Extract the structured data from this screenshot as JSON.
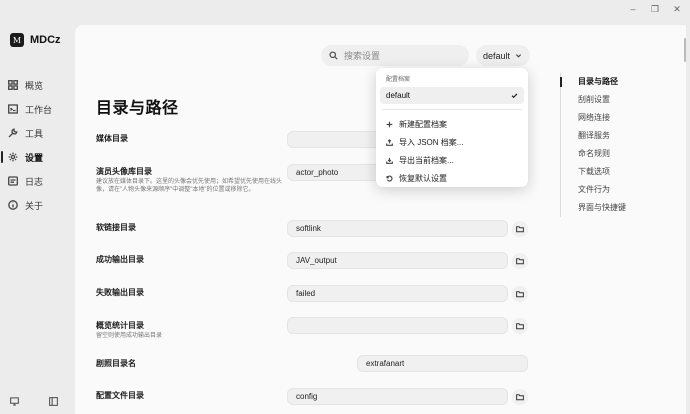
{
  "app": {
    "name": "MDCz",
    "logo_glyph": "M"
  },
  "window_controls": [
    "–",
    "❐",
    "✕"
  ],
  "sidebar": {
    "items": [
      {
        "label": "概览",
        "icon": "grid-icon",
        "active": false
      },
      {
        "label": "工作台",
        "icon": "terminal-icon",
        "active": false
      },
      {
        "label": "工具",
        "icon": "wrench-icon",
        "active": false
      },
      {
        "label": "设置",
        "icon": "gear-icon",
        "active": true
      },
      {
        "label": "日志",
        "icon": "log-icon",
        "active": false
      },
      {
        "label": "关于",
        "icon": "info-icon",
        "active": false
      }
    ]
  },
  "search": {
    "placeholder": "搜索设置"
  },
  "profile": {
    "current": "default"
  },
  "page": {
    "title": "目录与路径"
  },
  "rows": {
    "media_dir": {
      "label": "媒体目录",
      "value": ""
    },
    "actor_photo": {
      "label": "演员头像库目录",
      "desc": "建议放在媒体目录下。这里的头像会优先使用；如希望优先使用在线头像，请在\"人物头像来源顺序\"中调整\"本地\"的位置或移除它。",
      "value": "actor_photo"
    },
    "softlink": {
      "label": "软链接目录",
      "value": "softlink"
    },
    "success": {
      "label": "成功输出目录",
      "value": "JAV_output"
    },
    "failed": {
      "label": "失败输出目录",
      "value": "failed"
    },
    "overview": {
      "label": "概览统计目录",
      "desc": "留空则使用成功输出目录",
      "value": ""
    },
    "stills": {
      "label": "剧照目录名",
      "value": "extrafanart"
    },
    "config": {
      "label": "配置文件目录",
      "value": "config"
    }
  },
  "toc": {
    "items": [
      {
        "label": "目录与路径",
        "active": true
      },
      {
        "label": "刮削设置",
        "active": false
      },
      {
        "label": "网络连接",
        "active": false
      },
      {
        "label": "翻译服务",
        "active": false
      },
      {
        "label": "命名规则",
        "active": false
      },
      {
        "label": "下载选项",
        "active": false
      },
      {
        "label": "文件行为",
        "active": false
      },
      {
        "label": "界面与快捷键",
        "active": false
      }
    ]
  },
  "dropdown": {
    "header": "配置档案",
    "selected": "default",
    "items": [
      {
        "label": "新建配置档案",
        "icon": "plus-icon"
      },
      {
        "label": "导入 JSON 档案...",
        "icon": "upload-icon"
      },
      {
        "label": "导出当前档案...",
        "icon": "download-icon"
      },
      {
        "label": "恢复默认设置",
        "icon": "reset-icon"
      }
    ]
  }
}
